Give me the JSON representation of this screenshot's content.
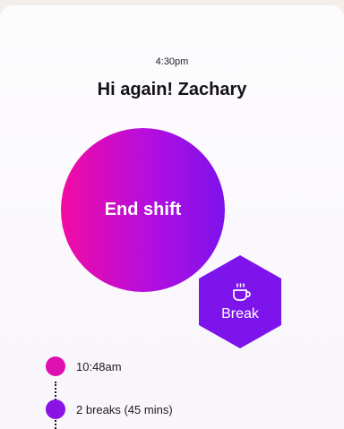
{
  "header": {
    "time": "4:30pm",
    "greeting": "Hi again! Zachary"
  },
  "actions": {
    "end_shift_label": "End shift",
    "break_label": "Break",
    "break_icon": "coffee-cup-icon"
  },
  "timeline": {
    "items": [
      {
        "text": "10:48am",
        "color": "#e00fb0"
      },
      {
        "text": "2 breaks (45 mins)",
        "color": "#8b14e4"
      }
    ]
  },
  "colors": {
    "gradient_start": "#f20ba2",
    "gradient_end": "#7d12ec",
    "break_purple": "#7d14ec"
  }
}
